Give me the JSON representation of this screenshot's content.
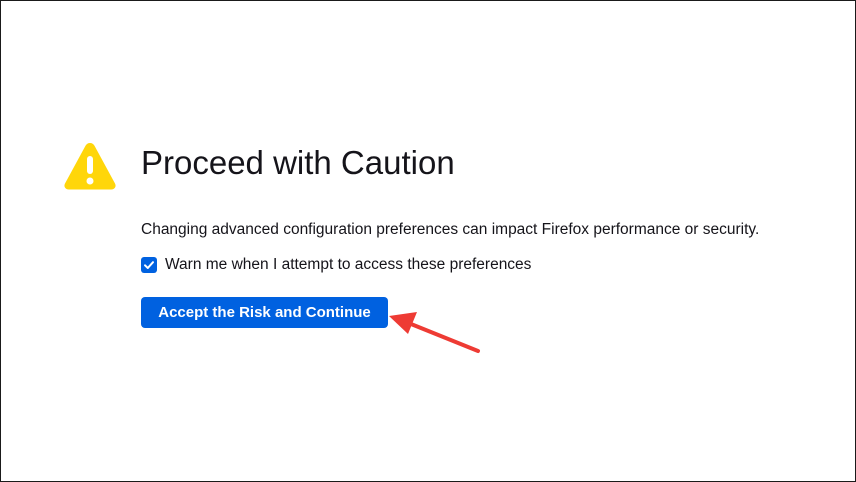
{
  "page": {
    "title": "Proceed with Caution",
    "description": "Changing advanced configuration preferences can impact Firefox performance or security.",
    "warn_checkbox": {
      "label": "Warn me when I attempt to access these preferences",
      "checked": true
    },
    "accept_button_label": "Accept the Risk and Continue"
  },
  "icons": {
    "warning": "warning-icon",
    "checkmark": "checkmark-icon",
    "annotation": "annotation-arrow"
  },
  "colors": {
    "warning_yellow": "#ffd60a",
    "accent_blue": "#0061e0",
    "annotation_red": "#ee3b34",
    "text": "#15141a"
  }
}
